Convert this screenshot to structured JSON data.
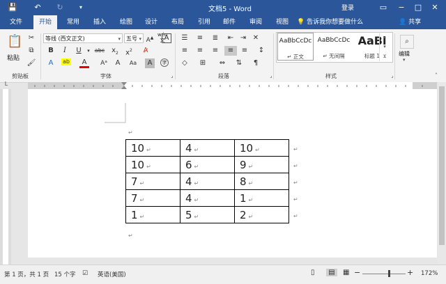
{
  "title_bar": {
    "doc_title": "文档5 - Word",
    "sign_in": "登录"
  },
  "tabs": [
    "文件",
    "开始",
    "常用",
    "插入",
    "绘图",
    "设计",
    "布局",
    "引用",
    "邮件",
    "审阅",
    "视图"
  ],
  "active_tab": "开始",
  "tell_me": "告诉我你想要做什么",
  "share": "共享",
  "ribbon": {
    "clipboard": {
      "paste": "粘贴",
      "label": "剪贴板"
    },
    "font": {
      "font_name": "等线 (西文正文)",
      "font_size": "五号",
      "wen": "wén",
      "label": "字体"
    },
    "paragraph": {
      "label": "段落"
    },
    "styles": {
      "label": "样式",
      "items": [
        {
          "sample": "AaBbCcDc",
          "name": "↵ 正文"
        },
        {
          "sample": "AaBbCcDc",
          "name": "↵ 无间隔"
        },
        {
          "sample": "AaBl",
          "name": "标题 1"
        }
      ]
    },
    "editing": {
      "label": "编辑"
    }
  },
  "table": [
    [
      "10",
      "4",
      "10"
    ],
    [
      "10",
      "6",
      "9"
    ],
    [
      "7",
      "4",
      "8"
    ],
    [
      "7",
      "4",
      "1"
    ],
    [
      "1",
      "5",
      "2"
    ]
  ],
  "status": {
    "page": "第 1 页，共 1 页",
    "words": "15 个字",
    "language": "英语(美国)",
    "zoom": "172%"
  }
}
